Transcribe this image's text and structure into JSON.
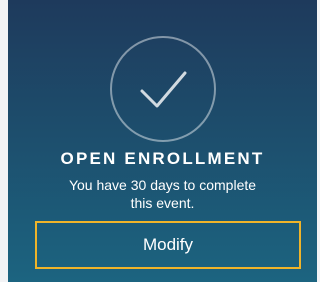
{
  "event": {
    "status_icon": "checkmark-circle-icon",
    "title": "OPEN ENROLLMENT",
    "description_line1": "You have 30 days to complete",
    "description_line2": "this event.",
    "action_label": "Modify"
  },
  "colors": {
    "card_top": "#1e3a5c",
    "card_bottom": "#1c6480",
    "button_border": "#f0b429",
    "text": "#ffffff"
  }
}
